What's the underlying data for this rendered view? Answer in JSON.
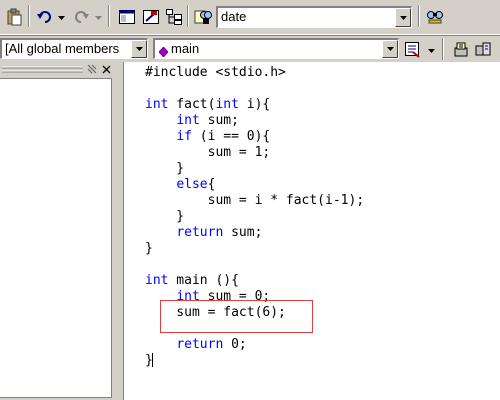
{
  "toolbar": {
    "find_combo_value": "date"
  },
  "context_bar": {
    "scope_value": "[All global members",
    "member_value": "main"
  },
  "editor": {
    "lines": [
      [
        {
          "t": "#include <stdio.h>",
          "c": ""
        }
      ],
      [],
      [
        {
          "t": "int",
          "c": "kw"
        },
        {
          "t": " fact(",
          "c": ""
        },
        {
          "t": "int",
          "c": "kw"
        },
        {
          "t": " i){",
          "c": ""
        }
      ],
      [
        {
          "t": "    ",
          "c": ""
        },
        {
          "t": "int",
          "c": "kw"
        },
        {
          "t": " sum;",
          "c": ""
        }
      ],
      [
        {
          "t": "    ",
          "c": ""
        },
        {
          "t": "if",
          "c": "kw"
        },
        {
          "t": " (i == 0){",
          "c": ""
        }
      ],
      [
        {
          "t": "        sum = 1;",
          "c": ""
        }
      ],
      [
        {
          "t": "    }",
          "c": ""
        }
      ],
      [
        {
          "t": "    ",
          "c": ""
        },
        {
          "t": "else",
          "c": "kw"
        },
        {
          "t": "{",
          "c": ""
        }
      ],
      [
        {
          "t": "        sum = i * fact(i-1);",
          "c": ""
        }
      ],
      [
        {
          "t": "    }",
          "c": ""
        }
      ],
      [
        {
          "t": "    ",
          "c": ""
        },
        {
          "t": "return",
          "c": "kw"
        },
        {
          "t": " sum;",
          "c": ""
        }
      ],
      [
        {
          "t": "}",
          "c": ""
        }
      ],
      [],
      [
        {
          "t": "int",
          "c": "kw"
        },
        {
          "t": " main (){",
          "c": ""
        }
      ],
      [
        {
          "t": "    ",
          "c": ""
        },
        {
          "t": "int",
          "c": "kw"
        },
        {
          "t": " sum = 0;",
          "c": ""
        }
      ],
      [
        {
          "t": "    sum = fact(6);",
          "c": ""
        }
      ],
      [],
      [
        {
          "t": "    ",
          "c": ""
        },
        {
          "t": "return",
          "c": "kw"
        },
        {
          "t": " 0;",
          "c": ""
        }
      ],
      [
        {
          "t": "}",
          "c": ""
        }
      ]
    ]
  },
  "colors": {
    "keyword": "#0000ff",
    "highlight_box": "#e04040",
    "chrome": "#d4d0c8"
  },
  "icons": {
    "toolbar": [
      "clipboard-paste-icon",
      "undo-icon",
      "redo-icon",
      "window-icon",
      "output-window-icon",
      "workspace-icon",
      "find-in-files-icon",
      "find-icon"
    ],
    "context_bar": [
      "member-diamond-icon",
      "wizard-bar-action-icon",
      "wizard-bar-options-icon"
    ]
  }
}
